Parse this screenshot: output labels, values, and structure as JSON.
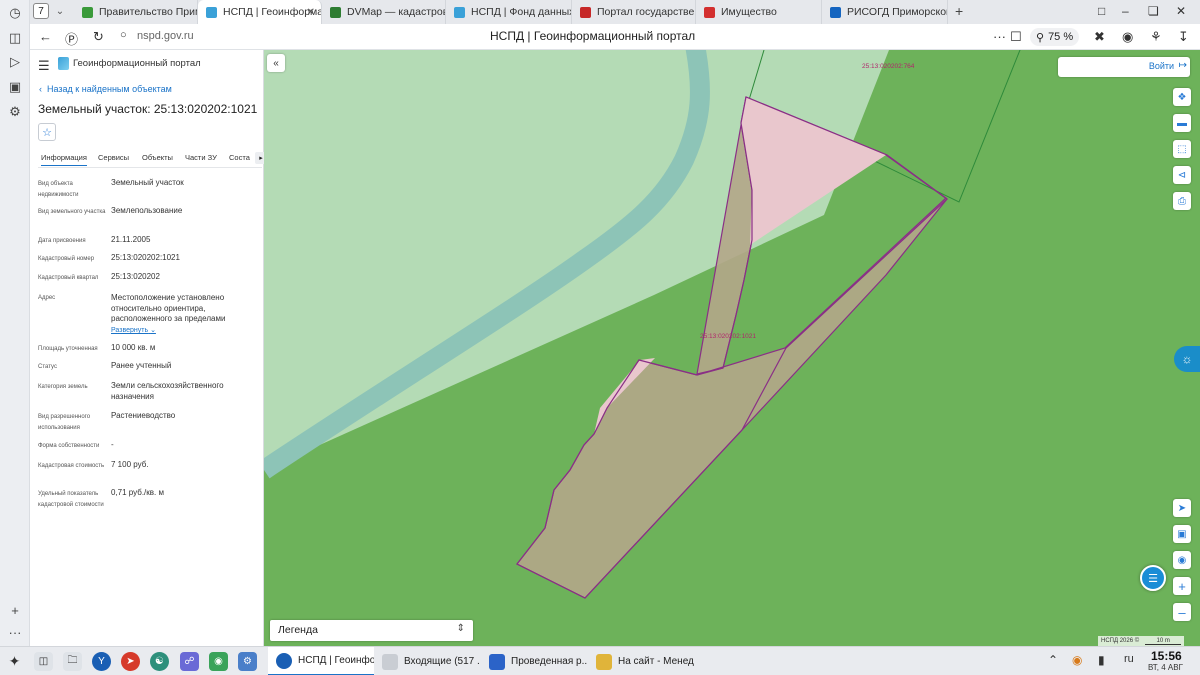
{
  "browser": {
    "tab_count": "7",
    "tabs": [
      {
        "label": "Правительство Приморск",
        "color": "#3a9a3a"
      },
      {
        "label": "НСПД | Геоинформацио",
        "color": "#3aa1d8"
      },
      {
        "label": "DVMap — кадастровая к",
        "color": "#2e7d32"
      },
      {
        "label": "НСПД | Фонд данных гос",
        "color": "#3aa1d8"
      },
      {
        "label": "Портал государственны",
        "color": "#c62828"
      },
      {
        "label": "Имущество",
        "color": "#d32f2f"
      },
      {
        "label": "РИСОГД Приморского кр",
        "color": "#1565c0"
      }
    ],
    "url": "nspd.gov.ru",
    "page_title": "НСПД | Геоинформационный портал",
    "zoom": "75 %"
  },
  "panel": {
    "portal_name": "Геоинформационный портал",
    "back_link": "Назад к найденным объектам",
    "title": "Земельный участок: 25:13:020202:1021",
    "tabs": [
      "Информация",
      "Сервисы",
      "Объекты",
      "Части ЗУ",
      "Соста"
    ],
    "rows": [
      {
        "label": "Вид объекта недвижимости",
        "value": "Земельный участок"
      },
      {
        "label": "Вид земельного участка",
        "value": "Землепользование"
      },
      {
        "label": "Дата присвоения",
        "value": "21.11.2005"
      },
      {
        "label": "Кадастровый номер",
        "value": "25:13:020202:1021"
      },
      {
        "label": "Кадастровый квартал",
        "value": "25:13:020202"
      },
      {
        "label": "Адрес",
        "value": "Местоположение установлено относительно ориентира, расположенного за пределами"
      },
      {
        "label": "Площадь уточненная",
        "value": "10 000 кв. м"
      },
      {
        "label": "Статус",
        "value": "Ранее учтенный"
      },
      {
        "label": "Категория земель",
        "value": "Земли сельскохозяйственного назначения"
      },
      {
        "label": "Вид разрешенного использования",
        "value": "Растениеводство"
      },
      {
        "label": "Форма собственности",
        "value": "-"
      },
      {
        "label": "Кадастровая стоимость",
        "value": "7 100 руб."
      },
      {
        "label": "Удельный показатель кадастровой стоимости",
        "value": "0,71 руб./кв. м"
      }
    ],
    "expand_link": "Развернуть"
  },
  "map": {
    "login": "Войти",
    "parcel_label_1": "25:13:020202:764",
    "parcel_label_2": "25:13:020202:1021",
    "legend": "Легенда",
    "attribution": "НСПД 2026 ©",
    "scale": "10 m"
  },
  "taskbar": {
    "windows": [
      {
        "label": "НСПД | Геоинфо...",
        "color": "#1a5fb4"
      },
      {
        "label": "Входящие (517 ...",
        "color": "#c9cdd3"
      },
      {
        "label": "Проведенная р...",
        "color": "#2b63c8"
      },
      {
        "label": "На сайт - Менед...",
        "color": "#e0b43a"
      }
    ],
    "lang": "ru",
    "time": "15:56",
    "date": "ВТ, 4 АВГ"
  }
}
